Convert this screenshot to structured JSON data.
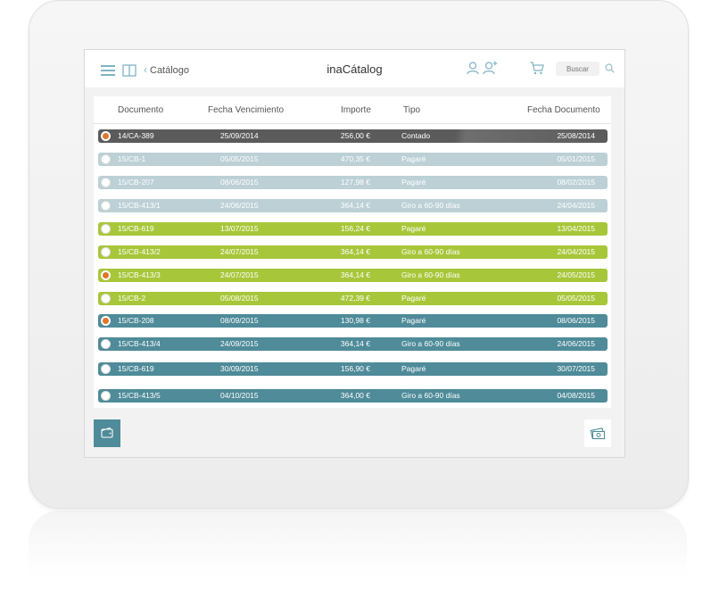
{
  "header": {
    "back_label": "Catálogo",
    "app_title": "inaCátalog",
    "search_placeholder": "Buscar"
  },
  "table": {
    "columns": [
      "Documento",
      "Fecha Vencimiento",
      "Importe",
      "Tipo",
      "Fecha Documento"
    ],
    "rows": [
      {
        "documento": "14/CA-389",
        "fecha_vencimiento": "25/09/2014",
        "importe": "256,00 €",
        "tipo": "Contado",
        "fecha_documento": "25/08/2014",
        "selected": true,
        "color": "#5b5b5b"
      },
      {
        "documento": "15/CB-1",
        "fecha_vencimiento": "05/05/2015",
        "importe": "470,35 €",
        "tipo": "Pagaré",
        "fecha_documento": "05/01/2015",
        "selected": false,
        "color": "#bcd0d5"
      },
      {
        "documento": "15/CB-207",
        "fecha_vencimiento": "08/06/2015",
        "importe": "127,98 €",
        "tipo": "Pagaré",
        "fecha_documento": "08/02/2015",
        "selected": false,
        "color": "#bcd0d5"
      },
      {
        "documento": "15/CB-413/1",
        "fecha_vencimiento": "24/06/2015",
        "importe": "364,14 €",
        "tipo": "Giro a 60-90 días",
        "fecha_documento": "24/04/2015",
        "selected": false,
        "color": "#bcd0d5"
      },
      {
        "documento": "15/CB-619",
        "fecha_vencimiento": "13/07/2015",
        "importe": "156,24 €",
        "tipo": "Pagaré",
        "fecha_documento": "13/04/2015",
        "selected": false,
        "color": "#a8c63a"
      },
      {
        "documento": "15/CB-413/2",
        "fecha_vencimiento": "24/07/2015",
        "importe": "364,14 €",
        "tipo": "Giro a 60-90 días",
        "fecha_documento": "24/04/2015",
        "selected": false,
        "color": "#a8c63a"
      },
      {
        "documento": "15/CB-413/3",
        "fecha_vencimiento": "24/07/2015",
        "importe": "364,14 €",
        "tipo": "Giro a 60-90 días",
        "fecha_documento": "24/05/2015",
        "selected": true,
        "color": "#a8c63a"
      },
      {
        "documento": "15/CB-2",
        "fecha_vencimiento": "05/08/2015",
        "importe": "472,39 €",
        "tipo": "Pagaré",
        "fecha_documento": "05/05/2015",
        "selected": false,
        "color": "#a8c63a"
      },
      {
        "documento": "15/CB-208",
        "fecha_vencimiento": "08/09/2015",
        "importe": "130,98 €",
        "tipo": "Pagaré",
        "fecha_documento": "08/06/2015",
        "selected": true,
        "color": "#4f8b99"
      },
      {
        "documento": "15/CB-413/4",
        "fecha_vencimiento": "24/09/2015",
        "importe": "364,14 €",
        "tipo": "Giro a 60-90 días",
        "fecha_documento": "24/06/2015",
        "selected": false,
        "color": "#4f8b99"
      },
      {
        "documento": "15/CB-619",
        "fecha_vencimiento": "30/09/2015",
        "importe": "156,90 €",
        "tipo": "Pagaré",
        "fecha_documento": "30/07/2015",
        "selected": false,
        "color": "#4f8b99"
      },
      {
        "documento": "15/CB-413/5",
        "fecha_vencimiento": "04/10/2015",
        "importe": "364,00 €",
        "tipo": "Giro a 60-90 días",
        "fecha_documento": "04/08/2015",
        "selected": false,
        "color": "#4f8b99"
      }
    ]
  },
  "icons": {
    "menu": "hamburger-menu-icon",
    "book": "book-icon",
    "back": "chevron-left-icon",
    "user": "user-icon",
    "add_user": "add-user-icon",
    "cart": "cart-icon",
    "search": "search-icon",
    "wallet": "wallet-icon",
    "money": "money-icon"
  },
  "colors": {
    "accent": "#7fb3c4",
    "teal": "#4f8b99",
    "green": "#a8c63a",
    "light_blue": "#bcd0d5",
    "dark": "#5b5b5b",
    "selected_radio": "#e0782a"
  }
}
